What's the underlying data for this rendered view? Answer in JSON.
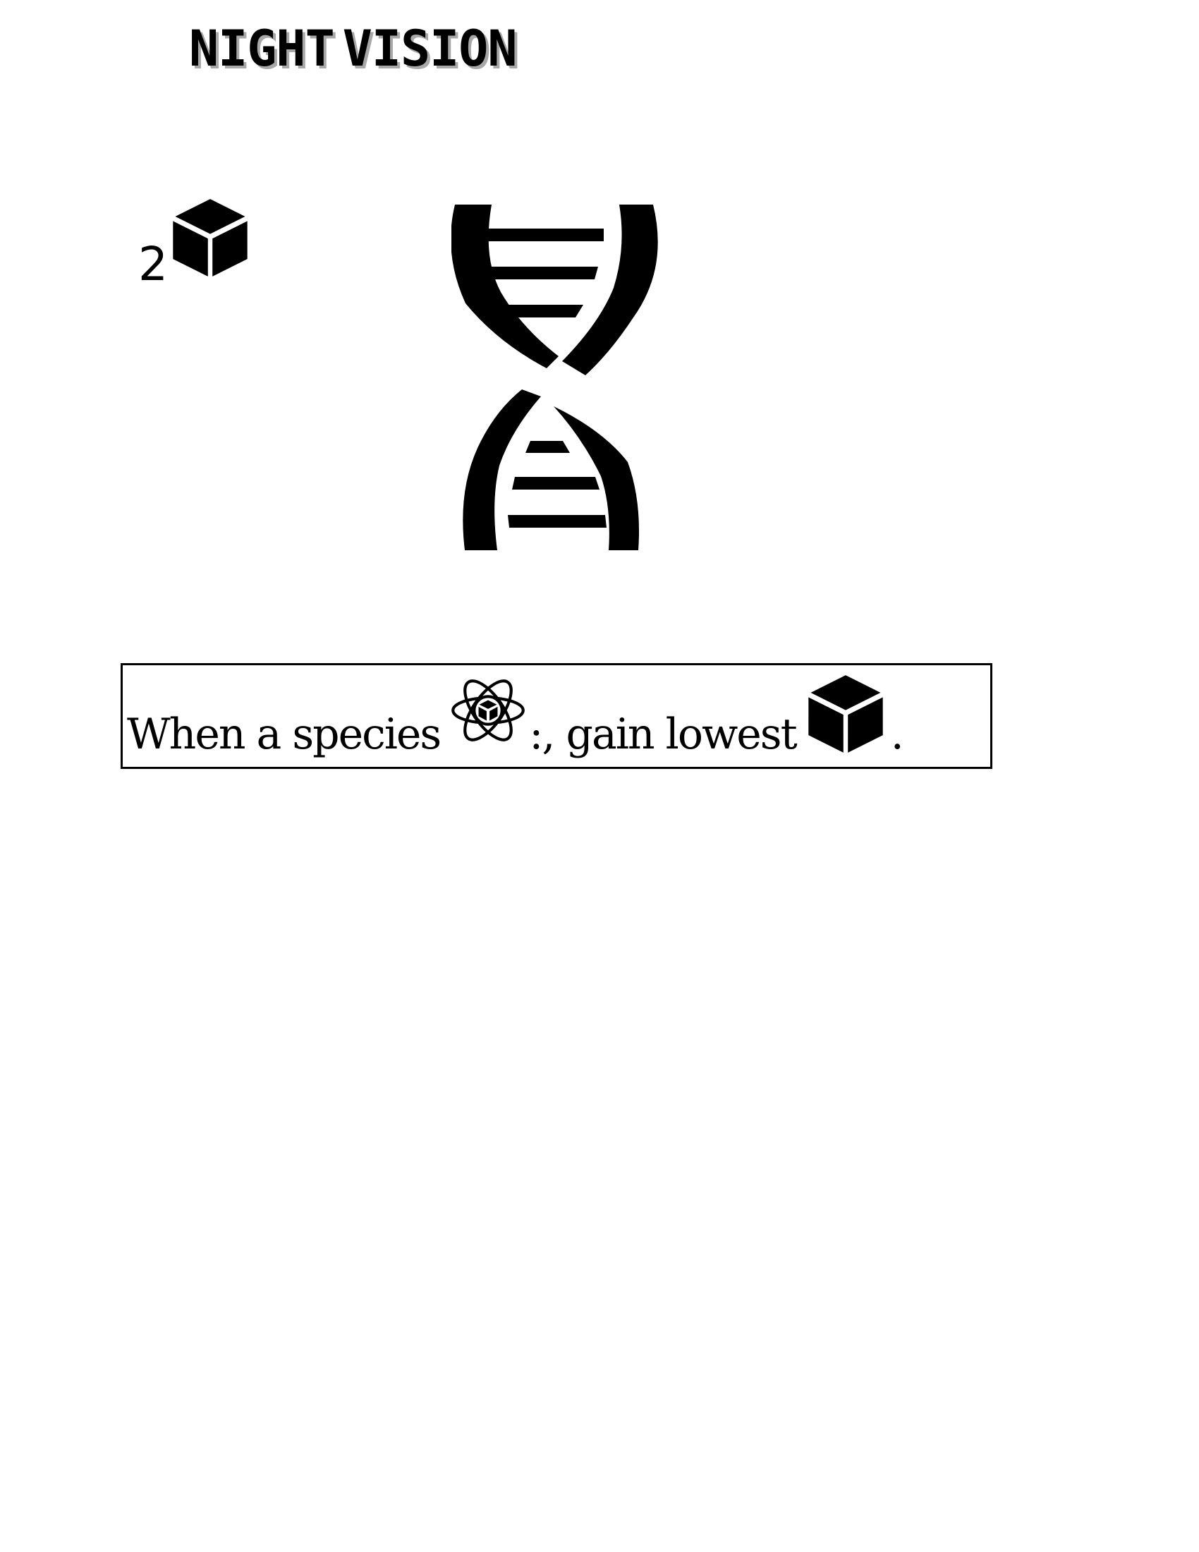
{
  "card": {
    "title": [
      "NIGHT",
      "VISION"
    ],
    "cost": {
      "number": "2",
      "icon": "cube-icon"
    },
    "art": {
      "icon": "dna-icon"
    },
    "ability": {
      "text_before": "When a species",
      "icon_species": "atom-cube-icon",
      "text_middle": ":, gain lowest",
      "icon_resource": "cube-icon",
      "text_after": "."
    }
  },
  "colors": {
    "ink": "#000000",
    "title_shadow": "#a8a8a8",
    "background": "#ffffff"
  }
}
